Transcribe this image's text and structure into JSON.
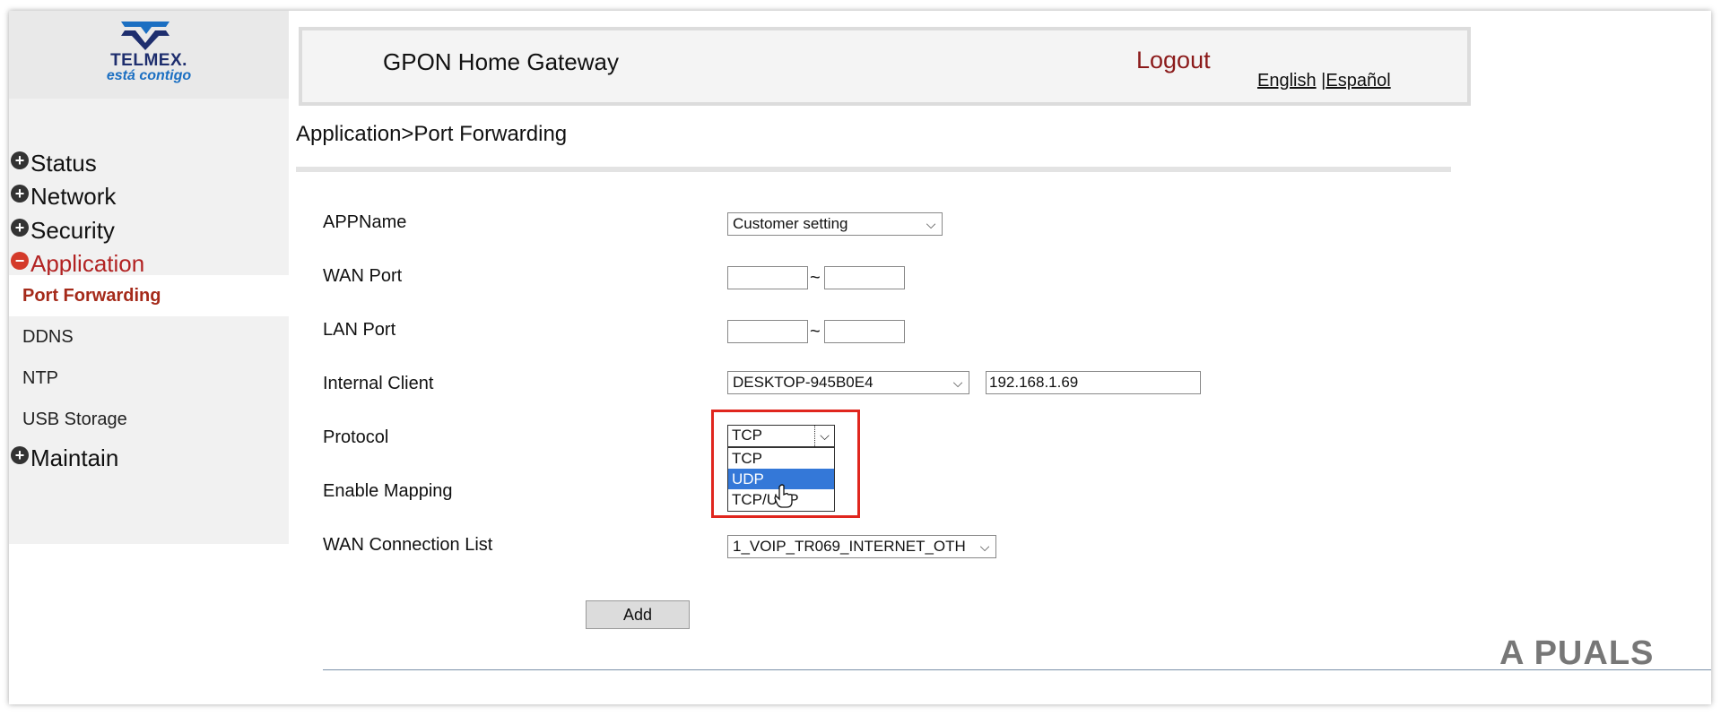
{
  "brand": {
    "name": "TELMEX.",
    "tagline": "está contigo",
    "color": "#1e2e6e"
  },
  "header": {
    "title": "GPON Home Gateway",
    "logout": "Logout",
    "lang_english": "English",
    "lang_separator": "|",
    "lang_spanish": "Español"
  },
  "sidebar": {
    "status": "Status",
    "network": "Network",
    "security": "Security",
    "application": "Application",
    "maintain": "Maintain",
    "sub_items": [
      "Port Forwarding",
      "DDNS",
      "NTP",
      "USB Storage"
    ]
  },
  "breadcrumb": "Application>Port Forwarding",
  "form": {
    "appname_label": "APPName",
    "appname_value": "Customer setting",
    "wan_port_label": "WAN Port",
    "lan_port_label": "LAN Port",
    "range_separator": "~",
    "internal_client_label": "Internal Client",
    "internal_client_value": "DESKTOP-945B0E4",
    "internal_ip_value": "192.168.1.69",
    "protocol_label": "Protocol",
    "protocol_value": "TCP",
    "protocol_options": [
      "TCP",
      "UDP",
      "TCP/UDP"
    ],
    "protocol_highlighted": "UDP",
    "enable_mapping_label": "Enable Mapping",
    "wan_connection_label": "WAN Connection List",
    "wan_connection_value": "1_VOIP_TR069_INTERNET_OTH",
    "add_button": "Add"
  },
  "watermark": "A  PUALS",
  "colors": {
    "accent_red": "#b22222",
    "highlight_box": "#e0261e",
    "selection_blue": "#3478d8"
  }
}
